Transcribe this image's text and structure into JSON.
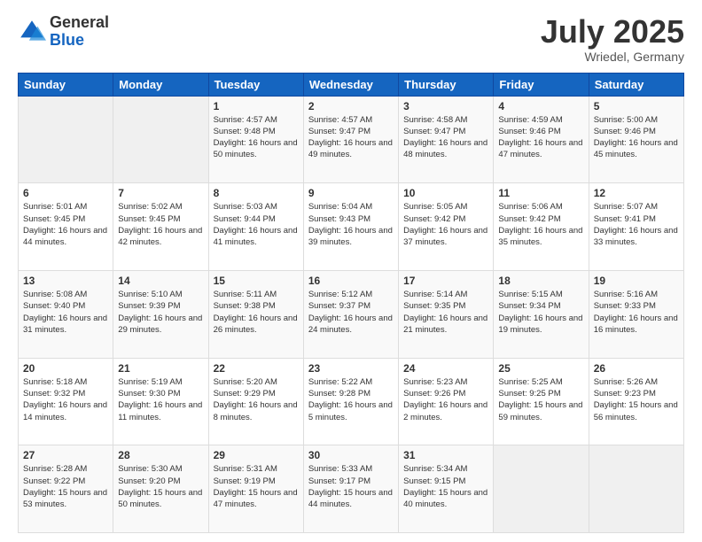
{
  "logo": {
    "general": "General",
    "blue": "Blue"
  },
  "title": {
    "month": "July 2025",
    "location": "Wriedel, Germany"
  },
  "days_of_week": [
    "Sunday",
    "Monday",
    "Tuesday",
    "Wednesday",
    "Thursday",
    "Friday",
    "Saturday"
  ],
  "weeks": [
    [
      {
        "day": "",
        "info": ""
      },
      {
        "day": "",
        "info": ""
      },
      {
        "day": "1",
        "info": "Sunrise: 4:57 AM\nSunset: 9:48 PM\nDaylight: 16 hours and 50 minutes."
      },
      {
        "day": "2",
        "info": "Sunrise: 4:57 AM\nSunset: 9:47 PM\nDaylight: 16 hours and 49 minutes."
      },
      {
        "day": "3",
        "info": "Sunrise: 4:58 AM\nSunset: 9:47 PM\nDaylight: 16 hours and 48 minutes."
      },
      {
        "day": "4",
        "info": "Sunrise: 4:59 AM\nSunset: 9:46 PM\nDaylight: 16 hours and 47 minutes."
      },
      {
        "day": "5",
        "info": "Sunrise: 5:00 AM\nSunset: 9:46 PM\nDaylight: 16 hours and 45 minutes."
      }
    ],
    [
      {
        "day": "6",
        "info": "Sunrise: 5:01 AM\nSunset: 9:45 PM\nDaylight: 16 hours and 44 minutes."
      },
      {
        "day": "7",
        "info": "Sunrise: 5:02 AM\nSunset: 9:45 PM\nDaylight: 16 hours and 42 minutes."
      },
      {
        "day": "8",
        "info": "Sunrise: 5:03 AM\nSunset: 9:44 PM\nDaylight: 16 hours and 41 minutes."
      },
      {
        "day": "9",
        "info": "Sunrise: 5:04 AM\nSunset: 9:43 PM\nDaylight: 16 hours and 39 minutes."
      },
      {
        "day": "10",
        "info": "Sunrise: 5:05 AM\nSunset: 9:42 PM\nDaylight: 16 hours and 37 minutes."
      },
      {
        "day": "11",
        "info": "Sunrise: 5:06 AM\nSunset: 9:42 PM\nDaylight: 16 hours and 35 minutes."
      },
      {
        "day": "12",
        "info": "Sunrise: 5:07 AM\nSunset: 9:41 PM\nDaylight: 16 hours and 33 minutes."
      }
    ],
    [
      {
        "day": "13",
        "info": "Sunrise: 5:08 AM\nSunset: 9:40 PM\nDaylight: 16 hours and 31 minutes."
      },
      {
        "day": "14",
        "info": "Sunrise: 5:10 AM\nSunset: 9:39 PM\nDaylight: 16 hours and 29 minutes."
      },
      {
        "day": "15",
        "info": "Sunrise: 5:11 AM\nSunset: 9:38 PM\nDaylight: 16 hours and 26 minutes."
      },
      {
        "day": "16",
        "info": "Sunrise: 5:12 AM\nSunset: 9:37 PM\nDaylight: 16 hours and 24 minutes."
      },
      {
        "day": "17",
        "info": "Sunrise: 5:14 AM\nSunset: 9:35 PM\nDaylight: 16 hours and 21 minutes."
      },
      {
        "day": "18",
        "info": "Sunrise: 5:15 AM\nSunset: 9:34 PM\nDaylight: 16 hours and 19 minutes."
      },
      {
        "day": "19",
        "info": "Sunrise: 5:16 AM\nSunset: 9:33 PM\nDaylight: 16 hours and 16 minutes."
      }
    ],
    [
      {
        "day": "20",
        "info": "Sunrise: 5:18 AM\nSunset: 9:32 PM\nDaylight: 16 hours and 14 minutes."
      },
      {
        "day": "21",
        "info": "Sunrise: 5:19 AM\nSunset: 9:30 PM\nDaylight: 16 hours and 11 minutes."
      },
      {
        "day": "22",
        "info": "Sunrise: 5:20 AM\nSunset: 9:29 PM\nDaylight: 16 hours and 8 minutes."
      },
      {
        "day": "23",
        "info": "Sunrise: 5:22 AM\nSunset: 9:28 PM\nDaylight: 16 hours and 5 minutes."
      },
      {
        "day": "24",
        "info": "Sunrise: 5:23 AM\nSunset: 9:26 PM\nDaylight: 16 hours and 2 minutes."
      },
      {
        "day": "25",
        "info": "Sunrise: 5:25 AM\nSunset: 9:25 PM\nDaylight: 15 hours and 59 minutes."
      },
      {
        "day": "26",
        "info": "Sunrise: 5:26 AM\nSunset: 9:23 PM\nDaylight: 15 hours and 56 minutes."
      }
    ],
    [
      {
        "day": "27",
        "info": "Sunrise: 5:28 AM\nSunset: 9:22 PM\nDaylight: 15 hours and 53 minutes."
      },
      {
        "day": "28",
        "info": "Sunrise: 5:30 AM\nSunset: 9:20 PM\nDaylight: 15 hours and 50 minutes."
      },
      {
        "day": "29",
        "info": "Sunrise: 5:31 AM\nSunset: 9:19 PM\nDaylight: 15 hours and 47 minutes."
      },
      {
        "day": "30",
        "info": "Sunrise: 5:33 AM\nSunset: 9:17 PM\nDaylight: 15 hours and 44 minutes."
      },
      {
        "day": "31",
        "info": "Sunrise: 5:34 AM\nSunset: 9:15 PM\nDaylight: 15 hours and 40 minutes."
      },
      {
        "day": "",
        "info": ""
      },
      {
        "day": "",
        "info": ""
      }
    ]
  ]
}
